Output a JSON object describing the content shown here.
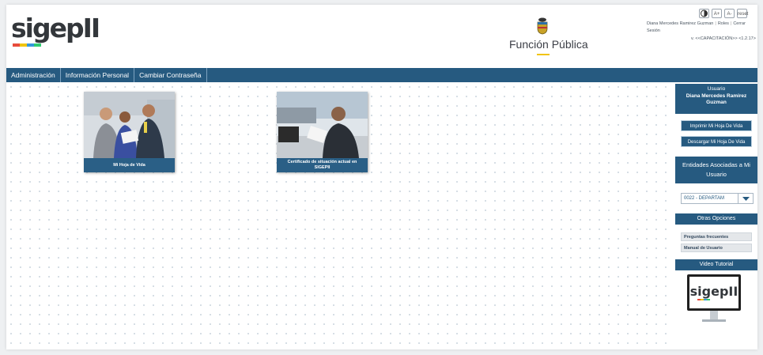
{
  "header": {
    "logo_text": "sigepII",
    "brand_text": "Función Pública",
    "accessibility": [
      "contrast-icon",
      "text-size-increase-icon",
      "text-size-decrease-icon",
      "reset-icon"
    ],
    "acc_labels": {
      "increase": "A+",
      "decrease": "A-",
      "reset": "reset"
    },
    "user_name": "Diana Mercedes Ramirez Guzman",
    "roles_link": "Roles",
    "logout_link_1": "Cerrar",
    "logout_link_2": "Sesión",
    "version": "v. <<CAPACITACIÓN>> <1.2.17>"
  },
  "nav": {
    "items": [
      "Administración",
      "Información Personal",
      "Cambiar Contraseña"
    ]
  },
  "cards": [
    {
      "label": "Mi Hoja de Vida"
    },
    {
      "label": "Certificado de situación actual en SIGEPII"
    }
  ],
  "sidebar": {
    "user_heading": "Usuario",
    "user_name": "Diana Mercedes Ramirez Guzman",
    "print_button": "Imprimir Mi Hoja De Vida",
    "download_button": "Descargar Mi Hoja De Vida",
    "entities_heading": "Entidades Asociadas a Mi Usuario",
    "entity_selected": "0022 - DEPARTAM",
    "other_options_heading": "Otras Opciones",
    "links": [
      "Preguntas frecuentes",
      "Manual de Usuario"
    ],
    "video_heading": "Video Tutorial",
    "video_logo_text": "sigepII"
  },
  "colors": {
    "primary": "#265a80",
    "logo_bars": [
      "#e74c3c",
      "#f1c40f",
      "#3498db",
      "#2ecc71"
    ]
  }
}
